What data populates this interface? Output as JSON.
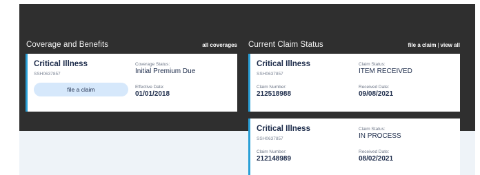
{
  "coverage": {
    "title": "Coverage and Benefits",
    "all_coverages_link": "all coverages",
    "card": {
      "name": "Critical Illness",
      "policy": "SSH0637857",
      "file_claim_label": "file a claim",
      "coverage_status_label": "Coverage Status:",
      "coverage_status_value": "Initial Premium Due",
      "effective_date_label": "Effective Date:",
      "effective_date_value": "01/01/2018"
    }
  },
  "claims": {
    "title": "Current Claim Status",
    "file_claim_link": "file a claim",
    "separator": "|",
    "view_all_link": "view all",
    "items": [
      {
        "name": "Critical Illness",
        "policy": "SSH0637857",
        "claim_status_label": "Claim Status:",
        "claim_status_value": "ITEM RECEIVED",
        "claim_number_label": "Claim Number:",
        "claim_number_value": "212518988",
        "received_date_label": "Received Date:",
        "received_date_value": "09/08/2021"
      },
      {
        "name": "Critical Illness",
        "policy": "SSH0637857",
        "claim_status_label": "Claim Status:",
        "claim_status_value": "IN PROCESS",
        "claim_number_label": "Claim Number:",
        "claim_number_value": "212148989",
        "received_date_label": "Received Date:",
        "received_date_value": "08/02/2021"
      }
    ]
  },
  "colors": {
    "dark_panel": "#2f2f2f",
    "light_panel": "#eef3f8",
    "card_accent": "#2a9fd6",
    "button_bg": "#d6e8fb",
    "text_primary": "#1c2b4a"
  }
}
